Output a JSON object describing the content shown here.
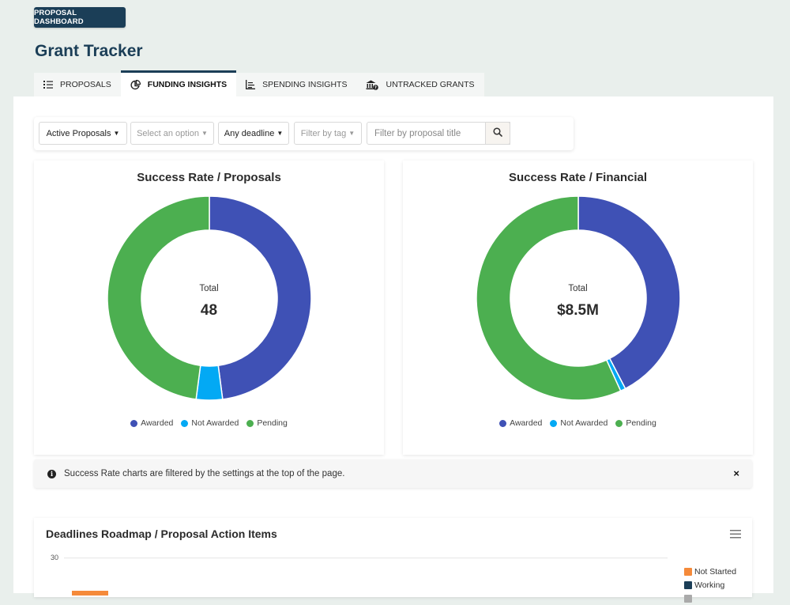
{
  "header": {
    "top_button": "PROPOSAL DASHBOARD",
    "title": "Grant Tracker"
  },
  "tabs": [
    {
      "label": "PROPOSALS",
      "icon": "list-icon",
      "active": false
    },
    {
      "label": "FUNDING INSIGHTS",
      "icon": "pie-chart-icon",
      "active": true
    },
    {
      "label": "SPENDING INSIGHTS",
      "icon": "bar-chart-icon",
      "active": false
    },
    {
      "label": "UNTRACKED GRANTS",
      "icon": "bank-question-icon",
      "active": false
    }
  ],
  "filters": {
    "status": "Active Proposals",
    "option": "Select an option",
    "deadline": "Any deadline",
    "tag": "Filter by tag",
    "search_placeholder": "Filter by proposal title",
    "search_value": ""
  },
  "colors": {
    "awarded": "#3f51b5",
    "not_awarded": "#03a9f4",
    "pending": "#4caf50",
    "not_started": "#f58a3a",
    "working": "#1b3e57",
    "brand": "#1b3e57"
  },
  "chart_data": [
    {
      "type": "pie",
      "title": "Success Rate / Proposals",
      "center_label": "Total",
      "center_value": "48",
      "categories": [
        "Awarded",
        "Not Awarded",
        "Pending"
      ],
      "values": [
        23,
        2,
        23
      ],
      "legend": "bottom"
    },
    {
      "type": "pie",
      "title": "Success Rate / Financial",
      "center_label": "Total",
      "center_value": "$8.5M",
      "categories": [
        "Awarded",
        "Not Awarded",
        "Pending"
      ],
      "values": [
        3.6,
        0.07,
        4.83
      ],
      "units": "$M",
      "legend": "bottom"
    },
    {
      "type": "bar",
      "title": "Deadlines Roadmap / Proposal Action Items",
      "y_ticks_visible": [
        "30"
      ],
      "legend": "right",
      "series": [
        {
          "name": "Not Started"
        },
        {
          "name": "Working"
        }
      ]
    }
  ],
  "alert": {
    "text": "Success Rate charts are filtered by the settings at the top of the page.",
    "close": "×"
  }
}
